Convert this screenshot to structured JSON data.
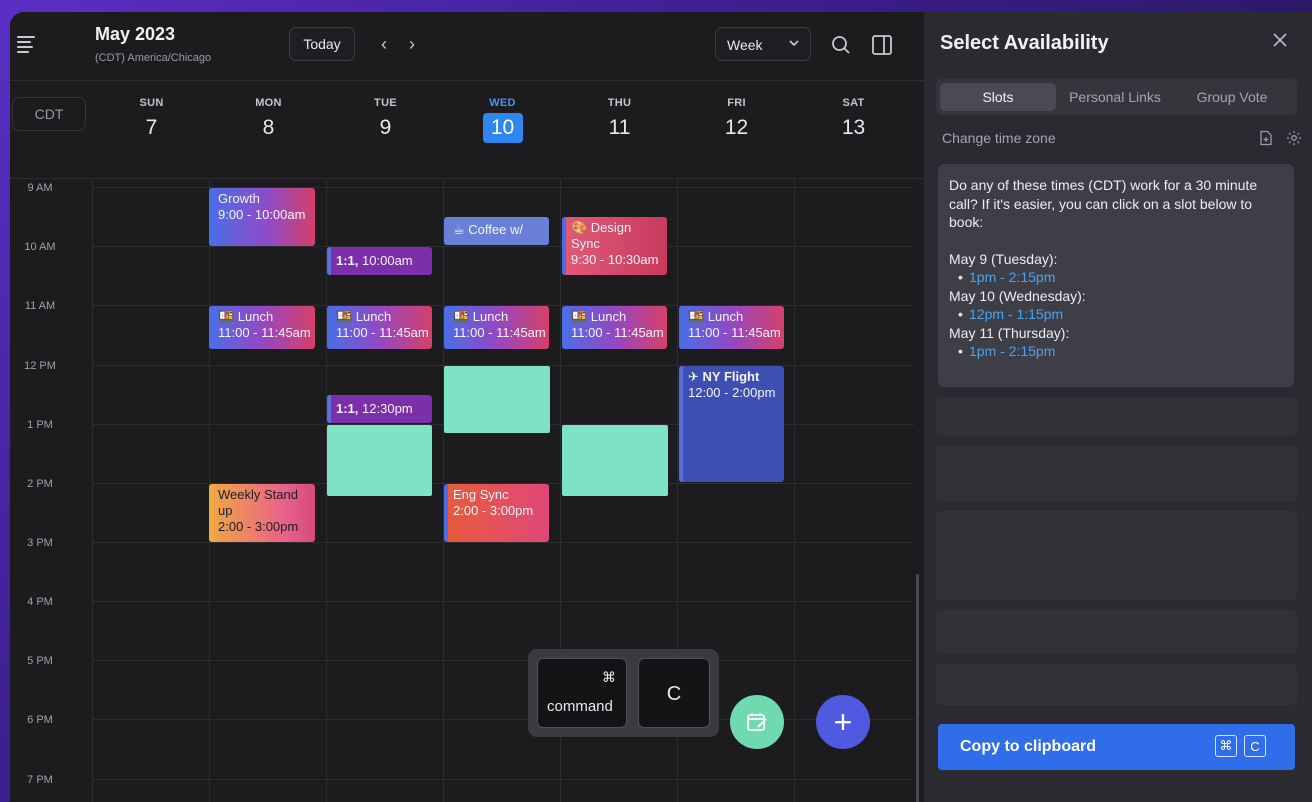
{
  "header": {
    "month": "May 2023",
    "timezone": "(CDT) America/Chicago",
    "today_label": "Today",
    "prev_label": "‹",
    "next_label": "›",
    "view_label": "Week"
  },
  "tz_label": "CDT",
  "days": [
    {
      "dow": "SUN",
      "num": "7"
    },
    {
      "dow": "MON",
      "num": "8"
    },
    {
      "dow": "TUE",
      "num": "9"
    },
    {
      "dow": "WED",
      "num": "10"
    },
    {
      "dow": "THU",
      "num": "11"
    },
    {
      "dow": "FRI",
      "num": "12"
    },
    {
      "dow": "SAT",
      "num": "13"
    }
  ],
  "hours": [
    "9 AM",
    "10 AM",
    "11 AM",
    "12 PM",
    "1 PM",
    "2 PM",
    "3 PM",
    "4 PM",
    "5 PM",
    "6 PM",
    "7 PM"
  ],
  "events": {
    "growth": {
      "title": "Growth",
      "time": "9:00 - 10:00am"
    },
    "one_on_one_1": {
      "title": "1:1,",
      "time": "10:00am"
    },
    "coffee": {
      "title": "☕ Coffee w/"
    },
    "design_sync": {
      "title": "🎨 Design Sync",
      "time": "9:30 - 10:30am"
    },
    "lunch_mon": {
      "title": "🍱 Lunch",
      "time": "11:00 - 11:45am"
    },
    "lunch_tue": {
      "title": "🍱 Lunch",
      "time": "11:00 - 11:45am"
    },
    "lunch_wed": {
      "title": "🍱 Lunch",
      "time": "11:00 - 11:45am"
    },
    "lunch_thu": {
      "title": "🍱 Lunch",
      "time": "11:00 - 11:45am"
    },
    "lunch_fri": {
      "title": "🍱 Lunch",
      "time": "11:00 - 11:45am"
    },
    "ny_flight": {
      "title": "✈ NY Flight",
      "time": "12:00 - 2:00pm"
    },
    "one_on_one_2": {
      "title": "1:1,",
      "time": "12:30pm"
    },
    "weekly": {
      "title": "Weekly Stand up",
      "time": "2:00 - 3:00pm"
    },
    "eng_sync": {
      "title": "Eng Sync",
      "time": "2:00 - 3:00pm"
    }
  },
  "keys": {
    "cmd_symbol": "⌘",
    "cmd_label": "command",
    "c_label": "C"
  },
  "fab": {
    "add_label": "+"
  },
  "panel": {
    "title": "Select Availability",
    "tabs": [
      "Slots",
      "Personal Links",
      "Group Vote"
    ],
    "change_tz": "Change time zone",
    "message_intro": "Do any of these times (CDT) work for a 30 minute call? If it's easier, you can click on a slot below to book:",
    "slots": [
      {
        "day": "May 9 (Tuesday):",
        "time": "1pm - 2:15pm"
      },
      {
        "day": "May 10 (Wednesday):",
        "time": "12pm - 1:15pm"
      },
      {
        "day": "May 11 (Thursday):",
        "time": "1pm - 2:15pm"
      }
    ],
    "copy_label": "Copy to clipboard",
    "copy_key1": "⌘",
    "copy_key2": "C"
  },
  "colors": {
    "accent": "#2f6ee8",
    "today": "#2f86ee",
    "slot_green": "#7de3c4",
    "link": "#4aa2f0"
  }
}
